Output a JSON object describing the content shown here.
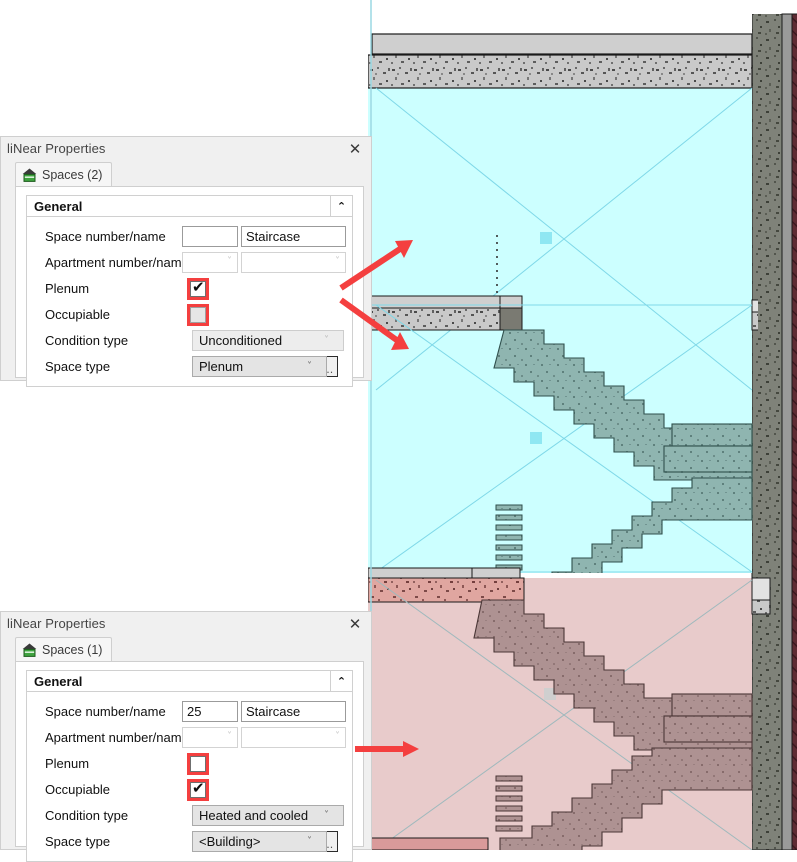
{
  "app": {
    "dialog_title": "liNear Properties",
    "close_icon": "✕",
    "collapse_icon": "⌃",
    "dropdown_icon": "˅",
    "ellipsis_label": "...",
    "check_glyph": "✔",
    "accent_red": "#f43f3f",
    "tab_icon_name": "building-house-icon"
  },
  "dialog_plenum": {
    "title": "liNear Properties",
    "tab": {
      "label": "Spaces (2)",
      "icon": "building-house-icon"
    },
    "group": {
      "label": "General"
    },
    "fields": {
      "space_number_label": "Space number/name",
      "space_number_value": "",
      "space_name_value": "Staircase",
      "apartment_label": "Apartment number/name",
      "apartment_number_value": "",
      "apartment_name_value": "",
      "plenum_label": "Plenum",
      "plenum_checked": true,
      "occupiable_label": "Occupiable",
      "occupiable_checked": false,
      "condition_type_label": "Condition type",
      "condition_type_value": "Unconditioned",
      "space_type_label": "Space type",
      "space_type_value": "Plenum"
    }
  },
  "dialog_occupiable": {
    "title": "liNear Properties",
    "tab": {
      "label": "Spaces (1)",
      "icon": "building-house-icon"
    },
    "group": {
      "label": "General"
    },
    "fields": {
      "space_number_label": "Space number/name",
      "space_number_value": "25",
      "space_name_value": "Staircase",
      "apartment_label": "Apartment number/name",
      "apartment_number_value": "",
      "apartment_name_value": "",
      "plenum_label": "Plenum",
      "plenum_checked": false,
      "occupiable_label": "Occupiable",
      "occupiable_checked": true,
      "condition_type_label": "Condition type",
      "condition_type_value": "Heated and cooled",
      "space_type_label": "Space type",
      "space_type_value": "<Building>"
    }
  },
  "drawing": {
    "description": "Building section through a staircase showing an upper plenum space (cyan) and a lower occupiable space (pink)",
    "colors": {
      "plenum_space_fill": "#ccffff",
      "occupiable_space_fill": "#e8cbcb",
      "plenum_stair_fill": "#8fb5b0",
      "occupiable_stair_fill": "#ae9292",
      "concrete_hatch_bg": "#c9c9c9",
      "slab_pink_hatch_bg": "#e0a6a0",
      "wall_concrete": "#7f8279",
      "wall_grey_layer": "#9a9a9a",
      "wall_maroon_hatch": "#5e2b33",
      "space_cross_line": "#7fd8e8",
      "arrow_red": "#f43f3f"
    }
  }
}
